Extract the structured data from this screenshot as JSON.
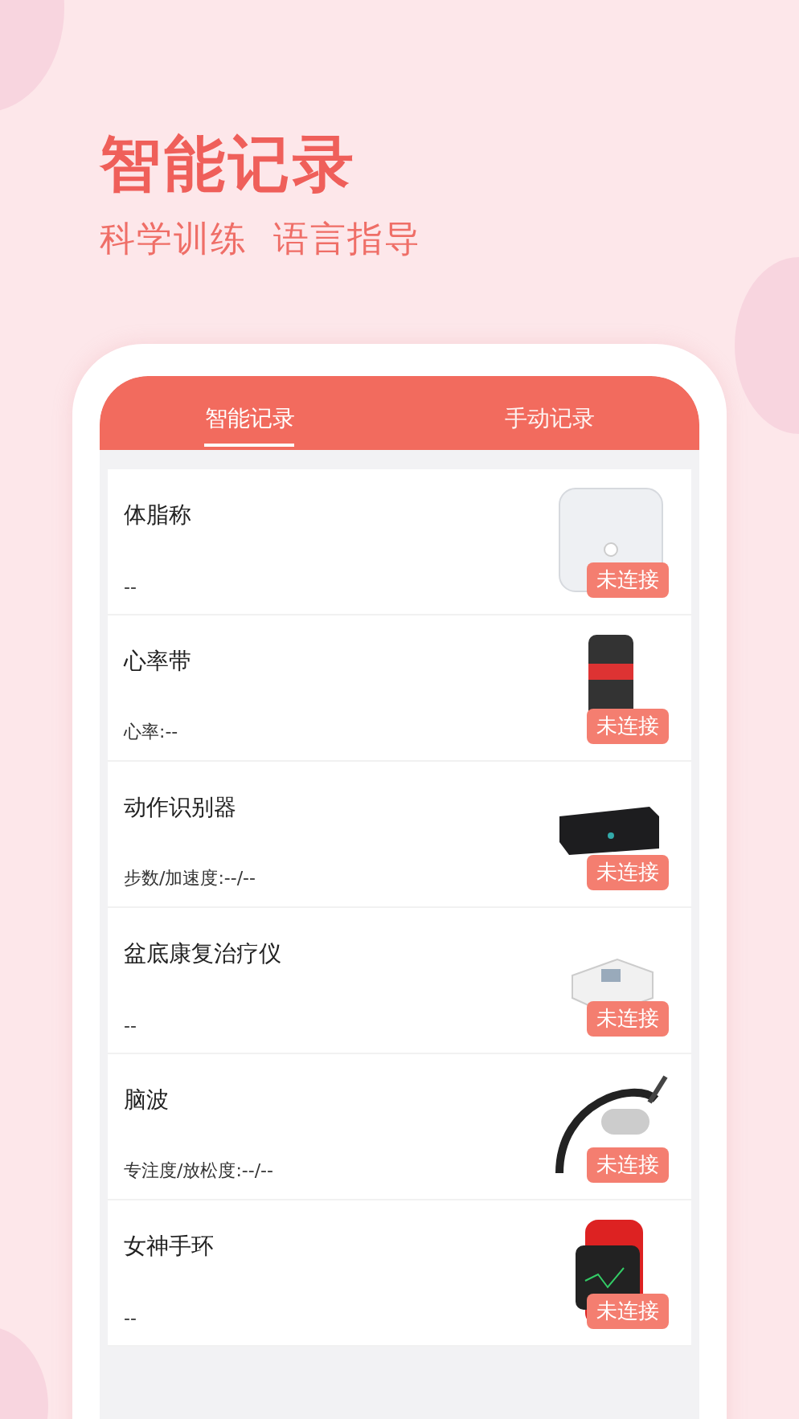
{
  "headline": {
    "title": "智能记录",
    "subtitle": "科学训练  语言指导"
  },
  "tabs": [
    {
      "label": "智能记录",
      "selected": true
    },
    {
      "label": "手动记录",
      "selected": false
    }
  ],
  "devices": [
    {
      "name": "体脂称",
      "reading": "--",
      "status": "未连接",
      "kind": "scale"
    },
    {
      "name": "心率带",
      "reading": "心率:--",
      "status": "未连接",
      "kind": "strap"
    },
    {
      "name": "动作识别器",
      "reading": "步数/加速度:--/--",
      "status": "未连接",
      "kind": "belt"
    },
    {
      "name": "盆底康复治疗仪",
      "reading": "--",
      "status": "未连接",
      "kind": "box"
    },
    {
      "name": "脑波",
      "reading": "专注度/放松度:--/--",
      "status": "未连接",
      "kind": "headset"
    },
    {
      "name": "女神手环",
      "reading": "--",
      "status": "未连接",
      "kind": "watch"
    }
  ]
}
